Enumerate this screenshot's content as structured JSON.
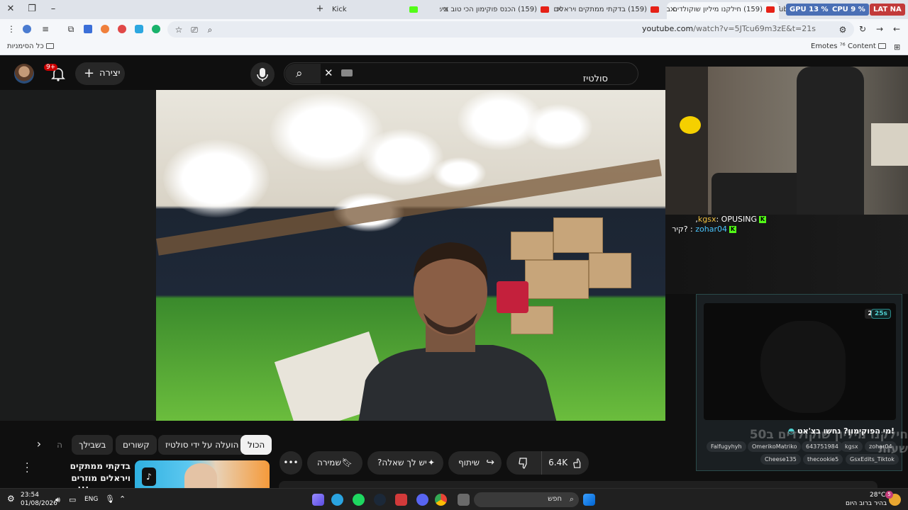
{
  "browser": {
    "tabs": [
      {
        "title": "(159) YouTube - מצב",
        "kind": "youtube"
      },
      {
        "title": "(159) חילקנו מיליון שוקולדים בס",
        "kind": "youtube",
        "active": true
      },
      {
        "title": "(159) בדקתי ממתקים ויראלים מ",
        "kind": "youtube"
      },
      {
        "title": "(159) הכנס פוקימון הכי טוב ביש",
        "kind": "youtube"
      },
      {
        "title": "Kick",
        "kind": "kick"
      }
    ],
    "perf": {
      "gpu_label": "GPU",
      "gpu_value": "13 %",
      "cpu_label": "CPU",
      "cpu_value": "9 %",
      "lat_label": "LAT",
      "lat_value": "NA",
      "na1": "NA"
    },
    "url_host": "youtube.com",
    "url_path": "/watch?v=5JTcu69m3zE&t=21s",
    "bookmarks": {
      "all": "כל הסימניות",
      "emotes": "Emotes",
      "content": "Content"
    }
  },
  "youtube": {
    "search_query": "סולטיז",
    "create_label": "יצירה",
    "notif_count": "9+",
    "filter_chips": [
      "הכול",
      "הועלה על ידי סולטיז",
      "קשורים",
      "בשבילך",
      "ה"
    ],
    "actions": {
      "likes": "6.4K",
      "share": "שיתוף",
      "ask": "יש לך שאלה?",
      "save": "שמירה"
    },
    "rec_title": "בדקתי ממתקים ויראלים מוזרים מהטיקטוק!!!"
  },
  "stream_overlay": {
    "chat": [
      {
        "user": "kgsx",
        "msg": "OPUSING,"
      },
      {
        "user": "zohar04",
        "msg": "?קיר"
      }
    ],
    "pokemon": {
      "round": "סבב 2",
      "timer": "25s",
      "question": "!מי הפוקימון? נחשו בצ'אט",
      "guessers": [
        "Falfugyhyh",
        "OmerikoMatriko",
        "643751984",
        "kgsx",
        "zohar04",
        "Cheese135",
        "thecookie5",
        "GsxEdits_Tiktok"
      ]
    },
    "bg_title": "חילקנו מיליון שוקולדים ב50 שעות"
  },
  "taskbar": {
    "time": "23:54",
    "date": "01/08/2026",
    "lang": "ENG",
    "search_placeholder": "חפש",
    "temp": "28°C",
    "weather": "בהיר ברוב היום",
    "badge": "5"
  },
  "colors": {
    "yt_red": "#ff0000",
    "kick_green": "#53fc18",
    "poke_teal": "#4fd1d1"
  }
}
